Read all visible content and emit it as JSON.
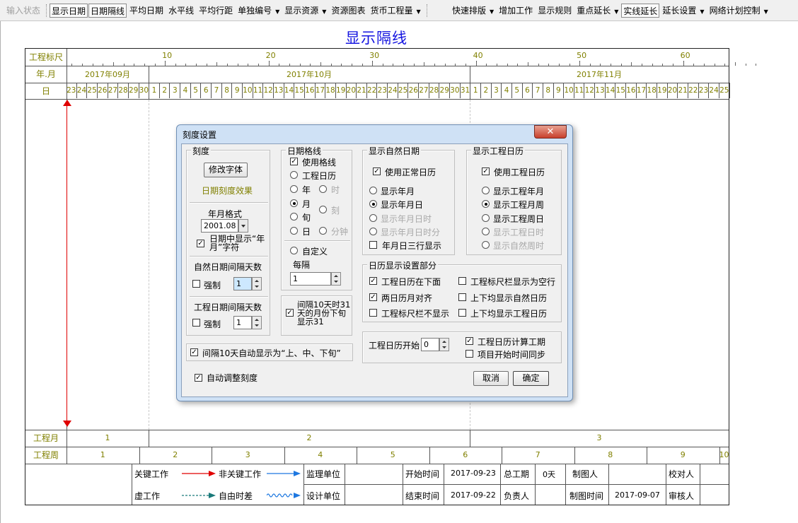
{
  "toolbar": {
    "left_items": [
      {
        "label": "输入状态",
        "state": "disabled",
        "dropdown": false
      },
      {
        "label": "显示日期",
        "state": "pressed",
        "dropdown": false
      },
      {
        "label": "日期隔线",
        "state": "pressed",
        "dropdown": false
      },
      {
        "label": "平均日期",
        "state": "normal",
        "dropdown": false
      },
      {
        "label": "水平线",
        "state": "normal",
        "dropdown": false
      },
      {
        "label": "平均行距",
        "state": "normal",
        "dropdown": false
      },
      {
        "label": "单独编号",
        "state": "normal",
        "dropdown": true
      },
      {
        "label": "显示资源",
        "state": "normal",
        "dropdown": true
      },
      {
        "label": "资源图表",
        "state": "normal",
        "dropdown": false
      },
      {
        "label": "货币工程量",
        "state": "normal",
        "dropdown": true
      }
    ],
    "right_items": [
      {
        "label": "快速排版",
        "state": "normal",
        "dropdown": true
      },
      {
        "label": "增加工作",
        "state": "normal",
        "dropdown": false
      },
      {
        "label": "显示规则",
        "state": "normal",
        "dropdown": false
      },
      {
        "label": "重点延长",
        "state": "normal",
        "dropdown": true
      },
      {
        "label": "实线延长",
        "state": "pressed",
        "dropdown": false
      },
      {
        "label": "延长设置",
        "state": "normal",
        "dropdown": true
      },
      {
        "label": "网络计划控制",
        "state": "normal",
        "dropdown": true
      }
    ]
  },
  "chart": {
    "title": "显示隔线",
    "row_labels": {
      "ruler": "工程标尺",
      "yearmonth": "年.月",
      "day": "日",
      "proj_month": "工程月",
      "proj_week": "工程周"
    },
    "ruler_ticks": [
      "10",
      "20",
      "30",
      "40",
      "50",
      "60"
    ],
    "months": [
      "2017年09月",
      "2017年10月",
      "2017年11月"
    ],
    "days_sep": [
      "23",
      "24",
      "25",
      "26",
      "27",
      "28",
      "29",
      "30"
    ],
    "days_oct": [
      "1",
      "2",
      "3",
      "4",
      "5",
      "6",
      "7",
      "8",
      "9",
      "10",
      "11",
      "12",
      "13",
      "14",
      "15",
      "16",
      "17",
      "18",
      "19",
      "20",
      "21",
      "22",
      "23",
      "24",
      "25",
      "26",
      "27",
      "28",
      "29",
      "30",
      "31"
    ],
    "days_nov": [
      "1",
      "2",
      "3",
      "4",
      "5",
      "6",
      "7",
      "8",
      "9",
      "10",
      "11",
      "12",
      "13",
      "14",
      "15",
      "16",
      "17",
      "18",
      "19",
      "20",
      "21",
      "22",
      "23",
      "24",
      "25"
    ],
    "proj_months": [
      "1",
      "2",
      "3"
    ],
    "proj_weeks": [
      "1",
      "2",
      "3",
      "4",
      "5",
      "6",
      "7",
      "8",
      "9",
      "10"
    ]
  },
  "legend": {
    "critical": "关键工作",
    "noncritical": "非关键工作",
    "virtual": "虚工作",
    "free_float": "自由时差",
    "colors": {
      "critical": "#e00000",
      "noncritical": "#1e78e0",
      "virtual": "#1a7a7a",
      "free_float": "#1e78e0"
    }
  },
  "info_table": {
    "supervisor": "监理单位",
    "designer": "设计单位",
    "start_time_label": "开始时间",
    "start_time": "2017-09-23",
    "end_time_label": "结束时间",
    "end_time": "2017-09-22",
    "total_duration_label": "总工期",
    "total_duration": "0天",
    "owner_label": "负责人",
    "drawer_label": "制图人",
    "draw_time_label": "制图时间",
    "draw_time": "2017-09-07",
    "checker_label": "校对人",
    "reviewer_label": "审核人"
  },
  "dialog": {
    "title": "刻度设置",
    "close_label": "✕",
    "scale": {
      "group": "刻度",
      "modify_font": "修改字体",
      "date_effect": "日期刻度效果",
      "ym_format_label": "年月格式",
      "ym_format_value": "2001.08",
      "show_ym_char": "日期中显示“年月”字符",
      "natural_interval_label": "自然日期间隔天数",
      "natural_force": "强制",
      "natural_value": "1",
      "project_interval_label": "工程日期间隔天数",
      "project_force": "强制",
      "project_value": "1"
    },
    "gridline": {
      "group": "日期格线",
      "use_grid": "使用格线",
      "proj_cal": "工程日历",
      "year": "年",
      "hour": "时",
      "month": "月",
      "xun": "旬",
      "ke": "刻",
      "day": "日",
      "minute": "分钟",
      "custom": "自定义",
      "every": "每隔",
      "every_value": "1",
      "show31": "间隔10天时31天的月份下旬显示31"
    },
    "natural": {
      "group": "显示自然日期",
      "use_normal": "使用正常日历",
      "show_ym": "显示年月",
      "show_ymd": "显示年月日",
      "show_ymdh": "显示年月日时",
      "show_ymdhm": "显示年月日时分",
      "three_lines": "年月日三行显示"
    },
    "project_cal": {
      "group": "显示工程日历",
      "use_proj": "使用工程日历",
      "show_pym": "显示工程年月",
      "show_pmw": "显示工程月周",
      "show_pwd": "显示工程周日",
      "show_pdh": "显示工程日时",
      "show_nwk": "显示自然周时"
    },
    "calendar_part": {
      "group": "日历显示设置部分",
      "proj_below": "工程日历在下面",
      "align": "两日历月对齐",
      "ruler_hide": "工程标尺栏不显示",
      "ruler_blank": "工程标尺栏显示为空行",
      "both_natural": "上下均显示自然日历",
      "both_project": "上下均显示工程日历"
    },
    "start": {
      "label": "工程日历开始",
      "value": "0",
      "calc_period": "工程日历计算工期",
      "sync": "项目开始时间同步"
    },
    "auto_xun": "间隔10天自动显示为“上、中、下旬”",
    "auto_adjust": "自动调整刻度",
    "cancel": "取消",
    "ok": "确定"
  }
}
